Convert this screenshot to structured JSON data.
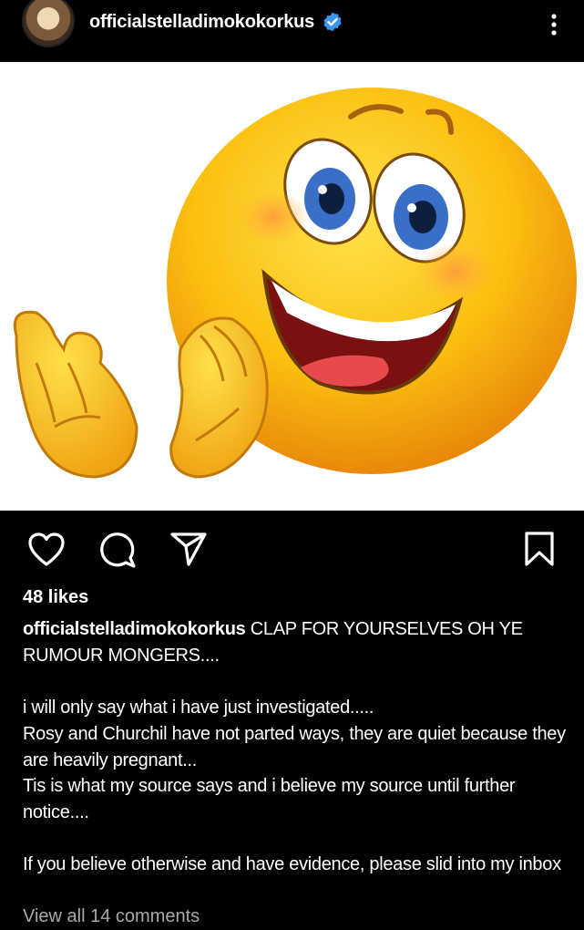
{
  "post": {
    "username": "officialstelladimokokorkus",
    "verified": true,
    "image_subject": "clapping-emoji",
    "likes": "48 likes",
    "caption_user": "officialstelladimokokorkus",
    "caption_first": " CLAP FOR YOURSELVES OH YE RUMOUR MONGERS....",
    "caption_lines": [
      "i will only say what i have just investigated.....",
      "Rosy and Churchil have not parted ways, they are quiet because they are heavily pregnant...",
      "Tis is what my source says and i believe my source until further notice...."
    ],
    "caption_last": "If you believe otherwise and have evidence, please slid into my inbox",
    "comments_link": "View all 14 comments"
  },
  "colors": {
    "background": "#000000",
    "verified_badge": "#3897f0",
    "muted_text": "#a8a8a8"
  },
  "icons": [
    "heart-icon",
    "comment-icon",
    "share-icon",
    "bookmark-icon",
    "more-options-icon",
    "verified-icon"
  ]
}
